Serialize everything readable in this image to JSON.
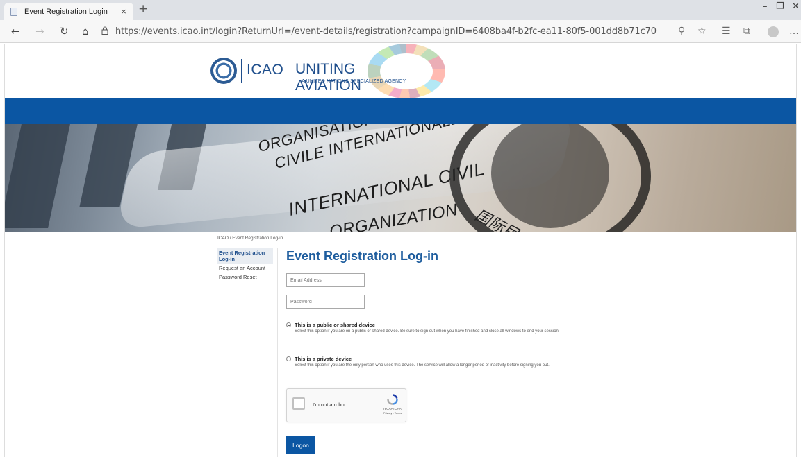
{
  "browser": {
    "tab_title": "Event Registration Login",
    "tab_close": "×",
    "new_tab": "+",
    "minimize": "–",
    "restore": "❐",
    "close": "✕",
    "url": "https://events.icao.int/login?ReturnUrl=/event-details/registration?campaignID=6408ba4f-b2fc-ea11-80f5-001dd8b71c70",
    "icons": [
      "back-icon",
      "forward-icon",
      "refresh-icon",
      "home-icon",
      "lock-icon",
      "zoom-icon",
      "favorite-star-icon",
      "favorites-list-icon",
      "collections-icon",
      "profile-icon",
      "more-icon"
    ]
  },
  "header": {
    "logo_icao": "ICAO",
    "logo_uniting": "UNITING AVIATION",
    "logo_sub": "A UNITED NATIONS SPECIALIZED AGENCY",
    "brand_color": "#0b56a3"
  },
  "banner": {
    "line1": "ORGANISATION DE L'AVIATION",
    "line2": "CIVILE INTERNATIONALE",
    "line3": "INTERNATIONAL CIVIL",
    "line4": "ORGANIZATION",
    "line5": "国际民航组织"
  },
  "breadcrumb": "ICAO / Event Registration Log-in",
  "sidebar": {
    "items": [
      {
        "label": "Event Registration Log-in",
        "active": true
      },
      {
        "label": "Request an Account",
        "active": false
      },
      {
        "label": "Password Reset",
        "active": false
      }
    ]
  },
  "form": {
    "title": "Event Registration Log-in",
    "email_placeholder": "Email Address",
    "password_placeholder": "Password",
    "public_label": "This is a public or shared device",
    "public_desc": "Select this option if you are on a public or shared device. Be sure to sign out when you have finished and close all windows to end your session.",
    "private_label": "This is a private device",
    "private_desc": "Select this option if you are the only person who uses this device. The service will allow a longer period of inactivity before signing you out.",
    "selected_option": "public",
    "logon_label": "Logon"
  },
  "captcha": {
    "label": "I'm not a robot",
    "brand": "reCAPTCHA",
    "links": "Privacy - Terms"
  }
}
